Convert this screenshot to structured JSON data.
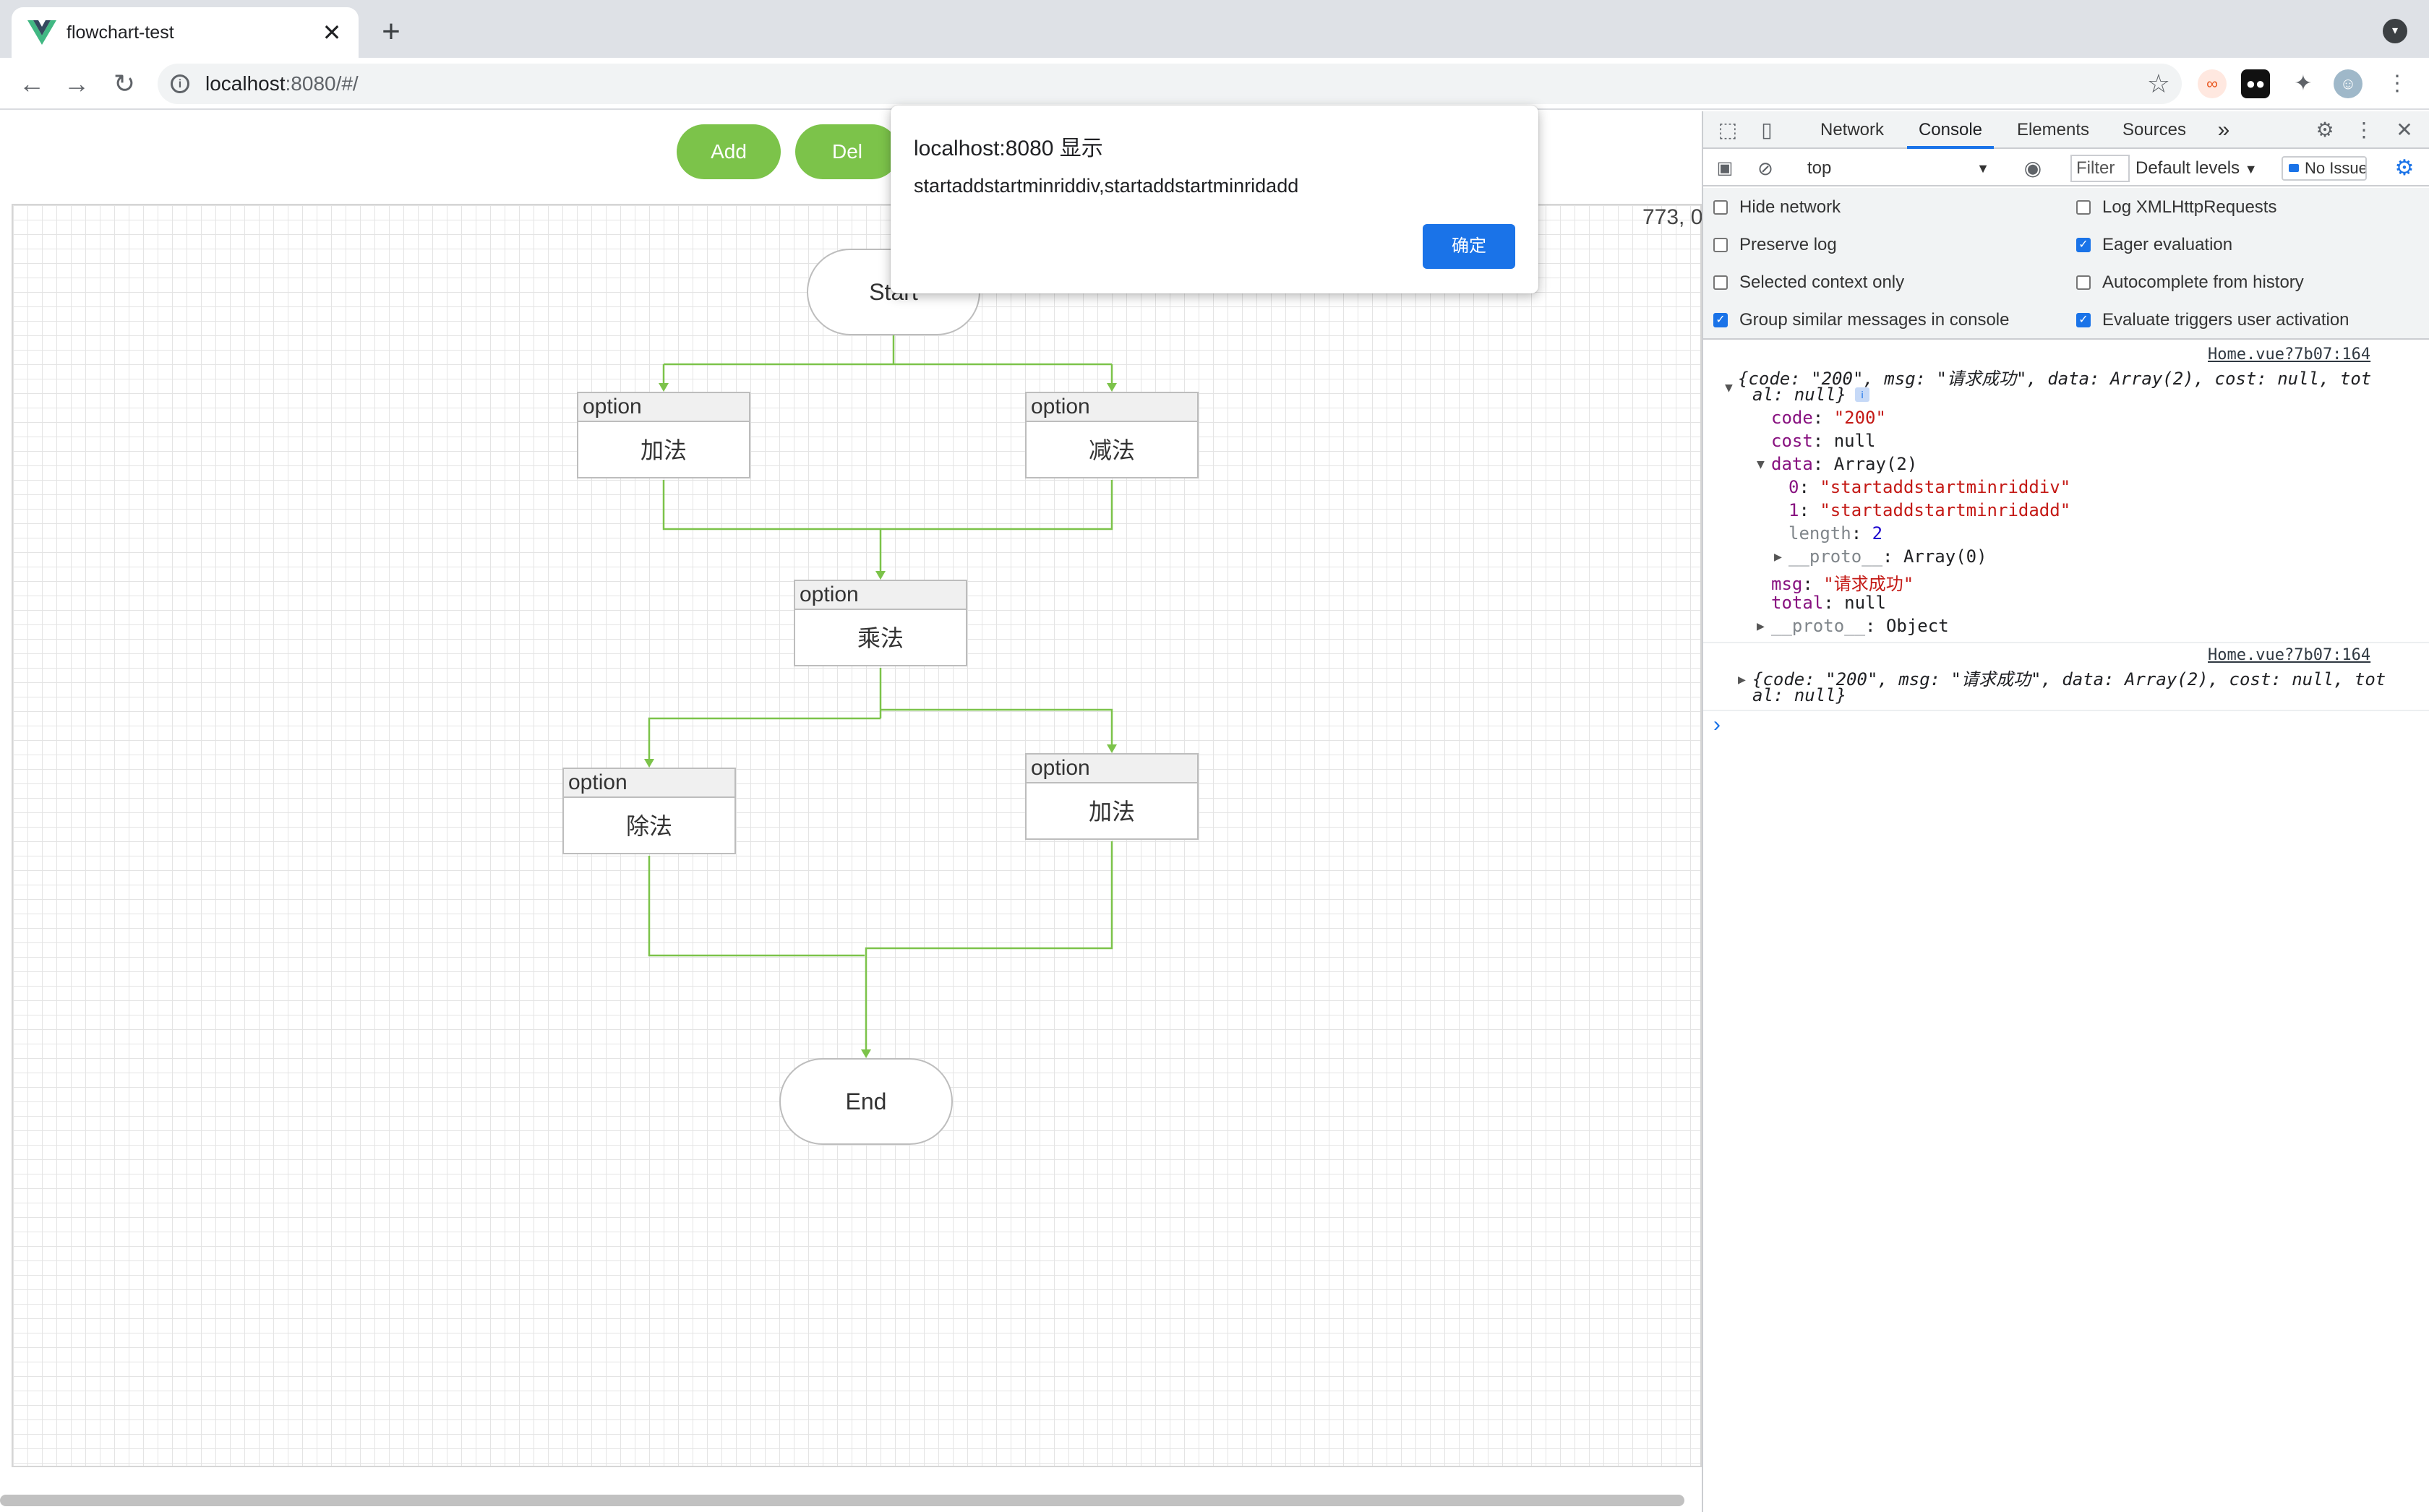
{
  "browser": {
    "tab_title": "flowchart-test",
    "tab_close": "✕",
    "new_tab": "+",
    "url_host": "localhost",
    "url_path": ":8080/#/"
  },
  "toolbar": {
    "add_label": "Add",
    "del_label": "Del"
  },
  "canvas": {
    "coord_readout": "773, 0"
  },
  "flowchart": {
    "start_label": "Start",
    "end_label": "End",
    "nodes": [
      {
        "header": "option",
        "body": "加法"
      },
      {
        "header": "option",
        "body": "减法"
      },
      {
        "header": "option",
        "body": "乘法"
      },
      {
        "header": "option",
        "body": "除法"
      },
      {
        "header": "option",
        "body": "加法"
      }
    ],
    "edge_color": "#7cc34a"
  },
  "dialog": {
    "title": "localhost:8080 显示",
    "message": "startaddstartminriddiv,startaddstartminridadd",
    "ok_label": "确定"
  },
  "devtools": {
    "tabs": [
      "Network",
      "Console",
      "Elements",
      "Sources"
    ],
    "more_tabs": "»",
    "context": "top",
    "filter_placeholder": "Filter",
    "levels": "Default levels",
    "issues": "No Issues",
    "settings_left": [
      {
        "label": "Hide network",
        "checked": false
      },
      {
        "label": "Preserve log",
        "checked": false
      },
      {
        "label": "Selected context only",
        "checked": false
      },
      {
        "label": "Group similar messages in console",
        "checked": true
      }
    ],
    "settings_right": [
      {
        "label": "Log XMLHttpRequests",
        "checked": false
      },
      {
        "label": "Eager evaluation",
        "checked": true
      },
      {
        "label": "Autocomplete from history",
        "checked": false
      },
      {
        "label": "Evaluate triggers user activation",
        "checked": true
      }
    ],
    "log1": {
      "source": "Home.vue?7b07:164",
      "summary_a": "{code: \"200\", msg: \"请求成功\", data: Array(2), cost: null, tot",
      "summary_b": "al: null}",
      "code_key": "code",
      "code_val": "\"200\"",
      "cost_key": "cost",
      "cost_val": "null",
      "data_key": "data",
      "data_val": "Array(2)",
      "item0_key": "0",
      "item0_val": "\"startaddstartminriddiv\"",
      "item1_key": "1",
      "item1_val": "\"startaddstartminridadd\"",
      "length_key": "length",
      "length_val": "2",
      "proto_arr_key": "__proto__",
      "proto_arr_val": "Array(0)",
      "msg_key": "msg",
      "msg_val": "\"请求成功\"",
      "total_key": "total",
      "total_val": "null",
      "proto_obj_key": "__proto__",
      "proto_obj_val": "Object"
    },
    "log2": {
      "source": "Home.vue?7b07:164",
      "summary_a": "{code: \"200\", msg: \"请求成功\", data: Array(2), cost: null, tot",
      "summary_b": "al: null}"
    },
    "prompt": "›"
  },
  "colors": {
    "accent_green": "#7cc34a",
    "devtools_blue": "#1a73e8"
  }
}
